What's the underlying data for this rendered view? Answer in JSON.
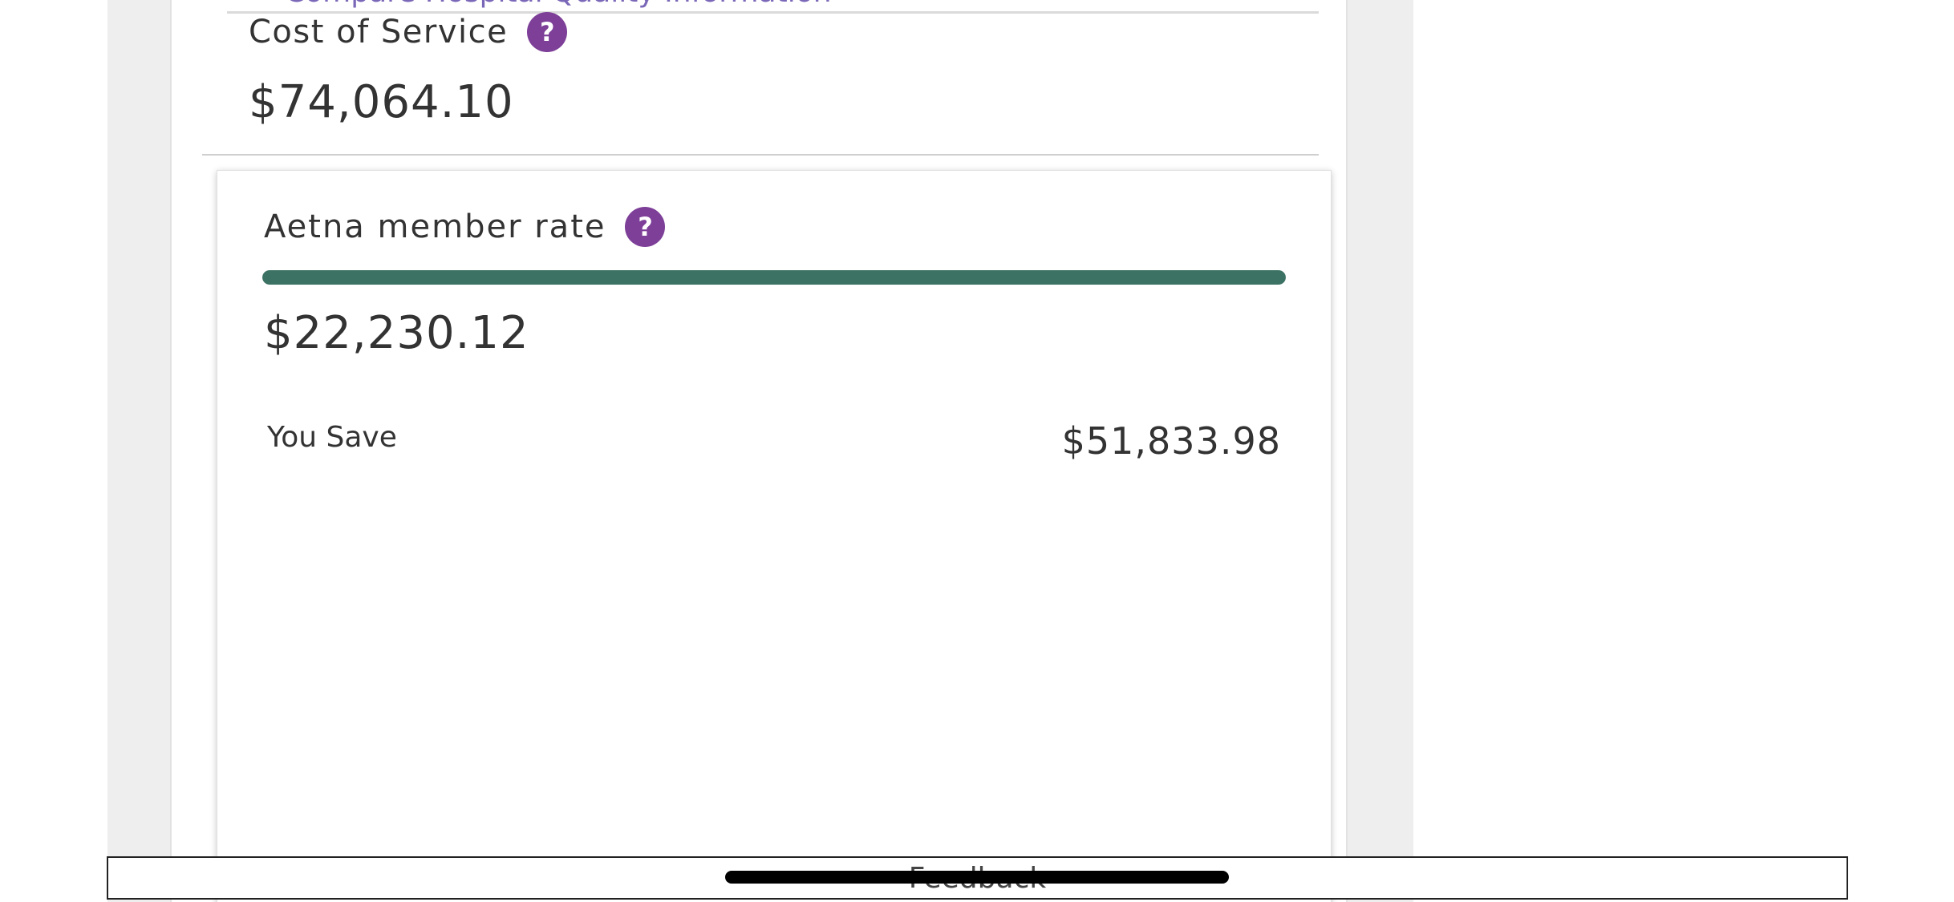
{
  "header": {
    "partial_link_text": "Compare Hospital Quality Information"
  },
  "cost_of_service": {
    "title": "Cost of Service",
    "help_glyph": "?",
    "value": "$74,064.10"
  },
  "member_rate": {
    "title": "Aetna member rate",
    "help_glyph": "?",
    "progress_percent": 100,
    "value": "$22,230.12",
    "savings_label": "You Save",
    "savings_value": "$51,833.98"
  },
  "footer": {
    "feedback_label": "Feedback"
  },
  "colors": {
    "help_badge": "#7d3f98",
    "progress_fill": "#3b7263",
    "link": "#7a67b8"
  },
  "icons": {
    "help": "question-mark-circle-icon"
  }
}
